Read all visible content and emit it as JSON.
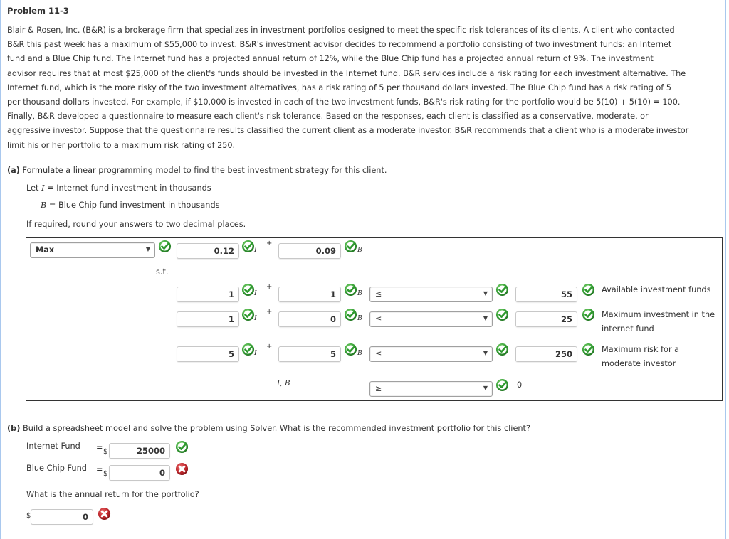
{
  "problem": {
    "title": "Problem 11-3",
    "intro_lines": [
      "Blair & Rosen, Inc. (B&R) is a brokerage firm that specializes in investment portfolios designed to meet the specific risk tolerances of its clients. A client who contacted",
      "B&R this past week has a maximum of $55,000 to invest. B&R's investment advisor decides to recommend a portfolio consisting of two investment funds: an Internet",
      "fund and a Blue Chip fund. The Internet fund has a projected annual return of 12%, while the Blue Chip fund has a projected annual return of 9%. The investment",
      "advisor requires that at most $25,000 of the client's funds should be invested in the Internet fund. B&R services include a risk rating for each investment alternative. The",
      "Internet fund, which is the more risky of the two investment alternatives, has a risk rating of 5 per thousand dollars invested. The Blue Chip fund has a risk rating of 5",
      "per thousand dollars invested. For example, if $10,000 is invested in each of the two investment funds, B&R's risk rating for the portfolio would be 5(10) + 5(10) = 100.",
      "Finally, B&R developed a questionnaire to measure each client's risk tolerance. Based on the responses, each client is classified as a conservative, moderate, or",
      "aggressive investor. Suppose that the questionnaire results classified the current client as a moderate investor. B&R recommends that a client who is a moderate investor",
      "limit his or her portfolio to a maximum risk rating of 250."
    ]
  },
  "part_a": {
    "label": "(a)",
    "question": "Formulate a linear programming model to find the best investment strategy for this client.",
    "let_prefix": "Let ",
    "var_I": "I",
    "var_I_def": " = Internet fund investment in thousands",
    "var_B": "B",
    "var_B_def": " = Blue Chip fund investment in thousands",
    "rounding_note": "If required, round your answers to two decimal places.",
    "model": {
      "objective": {
        "type": "Max",
        "coef_I": "0.12",
        "coef_B": "0.09"
      },
      "st_label": "s.t.",
      "plus": "+",
      "sub_I": "I",
      "sub_B": "B",
      "constraints": [
        {
          "coef_I": "1",
          "coef_B": "1",
          "relation": "≤",
          "rhs": "55",
          "description": "Available investment funds"
        },
        {
          "coef_I": "1",
          "coef_B": "0",
          "relation": "≤",
          "rhs": "25",
          "description_line1": "Maximum investment in the",
          "description_line2": "internet fund"
        },
        {
          "coef_I": "5",
          "coef_B": "5",
          "relation": "≤",
          "rhs": "250",
          "description_line1": "Maximum risk for a",
          "description_line2": "moderate investor"
        }
      ],
      "nonneg": {
        "vars": "I, B",
        "relation": "≥",
        "rhs": "0"
      }
    }
  },
  "part_b": {
    "label": "(b)",
    "question": "Build a spreadsheet model and solve the problem using Solver. What is the recommended investment portfolio for this client?",
    "internet_fund_label": "Internet Fund",
    "blue_chip_fund_label": "Blue Chip Fund",
    "equals": "=",
    "currency": "$",
    "internet_fund_value": "25000",
    "blue_chip_fund_value": "0",
    "annual_return_question": "What is the annual return for the portfolio?",
    "annual_return_value": "0"
  },
  "status_colors": {
    "correct": "#3aa33a",
    "incorrect": "#c0282e"
  }
}
